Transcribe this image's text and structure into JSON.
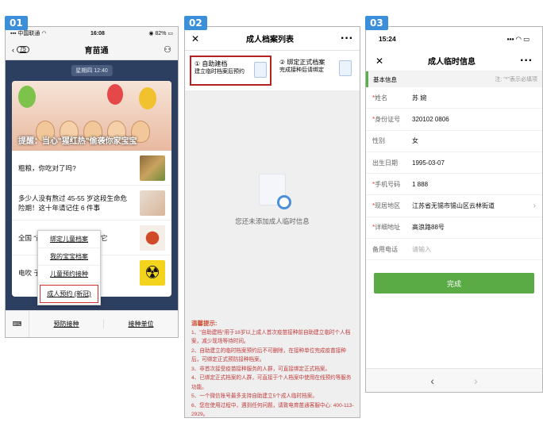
{
  "tags": [
    "01",
    "02",
    "03"
  ],
  "s1": {
    "status": {
      "carrier": "中国联通",
      "time": "16:08",
      "battery": "82%"
    },
    "nav": {
      "back_count": "75",
      "title": "育苗通"
    },
    "chat_time": "星期四 12:40",
    "banner_caption": "提醒：当心\"猩红热\"偷袭你家宝宝",
    "items": [
      {
        "text": "粗粮，你吃对了吗?"
      },
      {
        "text": "多少人没有熬过 45-55 岁这段生命危险期！这十年请记住 6 件事"
      },
      {
        "text": "全国 “最沉默的小伙 意”爱护它"
      },
      {
        "text": "电吹 子不能用?"
      }
    ],
    "popup": [
      "绑定儿童档案",
      "我的宝宝档案",
      "儿童预约接种",
      "成人预约 (新冠)"
    ],
    "bottom_tabs": [
      "预防接种",
      "接种单位"
    ]
  },
  "s2": {
    "nav_title": "成人档案列表",
    "options": [
      {
        "title": "① 自助建档",
        "sub": "建立临时档案后预约"
      },
      {
        "title": "② 绑定正式档案",
        "sub": "完成接种后请绑定"
      }
    ],
    "empty_msg": "您还未添加成人临时信息",
    "tips_title": "温馨提示:",
    "tips": [
      "1、\"自助建档\"用于18岁以上成人首次疫苗接种前自助建立临时个人档案，减少现场等待时间。",
      "2、自助建立的临时档案预约后不可删除，在接种单位完成疫苗接种后，可绑定正式预防接种档案。",
      "3、非首次接受疫苗接种服务的人群，可直接绑定正式档案。",
      "4、已绑定正式档案的人群，可直接于个人档案中使用在线预约等服务功能。",
      "5、一个微信账号最多支持自助建立5个成人临时档案。",
      "6、您在使用过程中，遇到任何问题，请致电育苗通客服中心: 400-113-2929。"
    ]
  },
  "s3": {
    "status_time": "15:24",
    "nav_title": "成人临时信息",
    "section": {
      "label": "基本信息",
      "note": "注: \"*\"表示必填项"
    },
    "fields": [
      {
        "label": "姓名",
        "value": "苏 婉",
        "required": true
      },
      {
        "label": "身份证号",
        "value": "320102 0806",
        "required": true
      },
      {
        "label": "性别",
        "value": "女",
        "required": false
      },
      {
        "label": "出生日期",
        "value": "1995-03-07",
        "required": false
      },
      {
        "label": "手机号码",
        "value": "1 888",
        "required": true
      },
      {
        "label": "现居地区",
        "value": "江苏省无锡市锡山区云林街道",
        "required": true
      },
      {
        "label": "详细地址",
        "value": "高浪路88号",
        "required": true
      },
      {
        "label": "备用电话",
        "placeholder": "请输入",
        "required": false
      }
    ],
    "submit": "完成"
  }
}
